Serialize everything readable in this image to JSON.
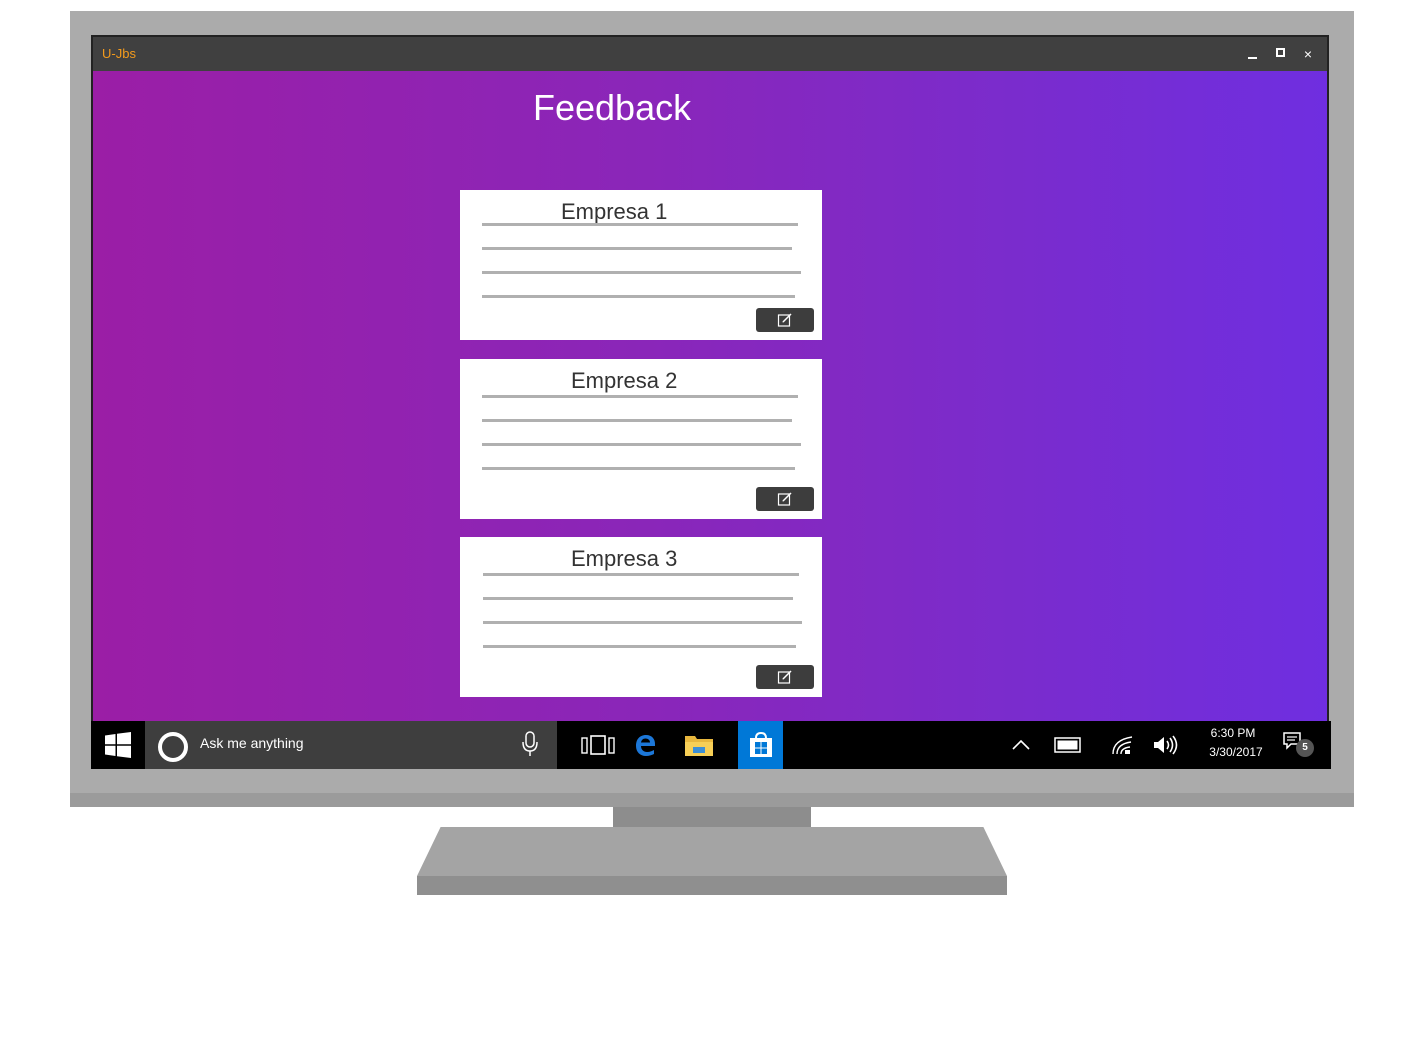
{
  "window": {
    "app_title": "U-Jbs",
    "minimize_icon": "minimize-icon",
    "maximize_icon": "maximize-icon",
    "close_label": "×"
  },
  "page": {
    "title": "Feedback"
  },
  "cards": [
    {
      "title": "Empresa 1",
      "edit_icon": "edit-icon"
    },
    {
      "title": "Empresa 2",
      "edit_icon": "edit-icon"
    },
    {
      "title": "Empresa 3",
      "edit_icon": "edit-icon"
    }
  ],
  "taskbar": {
    "search_placeholder": "Ask me anything",
    "icons": [
      "windows-start-icon",
      "cortana-icon",
      "microphone-icon",
      "task-view-icon",
      "edge-icon",
      "file-explorer-icon",
      "store-icon",
      "chevron-up-icon",
      "battery-icon",
      "wifi-icon",
      "volume-icon",
      "notification-icon"
    ],
    "time": "6:30 PM",
    "date": "3/30/2017",
    "notification_count": "5"
  },
  "colors": {
    "title_bar": "#404040",
    "app_title": "#f29a1c",
    "gradient_start": "#9b1ea6",
    "gradient_end": "#6f2ee0",
    "store_highlight": "#0078d7"
  }
}
